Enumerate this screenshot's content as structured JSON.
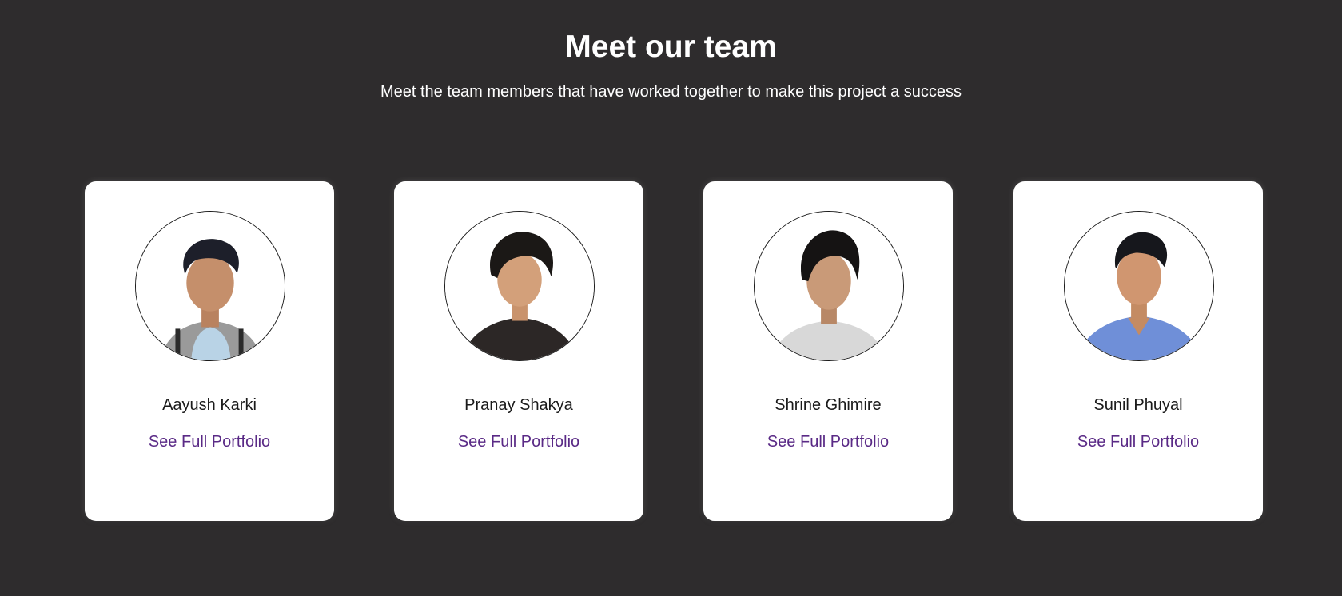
{
  "header": {
    "title": "Meet our team",
    "subtitle": "Meet the team members that have worked together to make this project a success"
  },
  "team": [
    {
      "name": "Aayush Karki",
      "link_label": "See Full Portfolio"
    },
    {
      "name": "Pranay Shakya",
      "link_label": "See Full Portfolio"
    },
    {
      "name": "Shrine Ghimire",
      "link_label": "See Full Portfolio"
    },
    {
      "name": "Sunil Phuyal",
      "link_label": "See Full Portfolio"
    }
  ],
  "colors": {
    "background": "#2e2c2d",
    "card": "#ffffff",
    "link": "#5a2a86",
    "text": "#1a1a1a"
  }
}
